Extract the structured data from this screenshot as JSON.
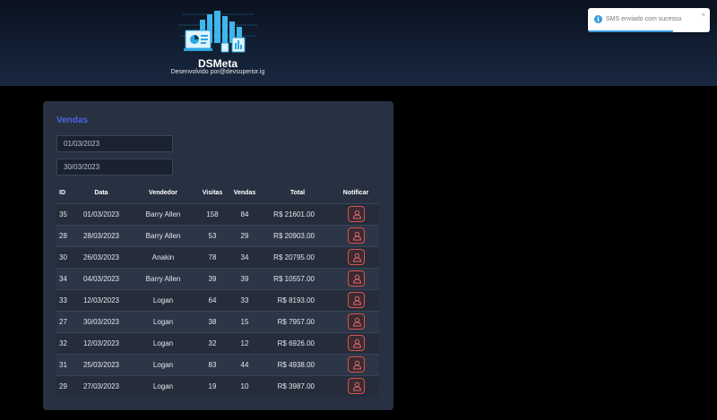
{
  "header": {
    "brand": "DSMeta",
    "subtitle": "Desenvolvido por@devsuperior.ig"
  },
  "toast": {
    "message": "SMS enviado com sucesso",
    "close": "×",
    "icon": "info-icon",
    "progress": 0.7
  },
  "card": {
    "title": "Vendas",
    "min_date": "01/03/2023",
    "max_date": "30/03/2023"
  },
  "table": {
    "headers": {
      "id": "ID",
      "date": "Data",
      "seller": "Vendedor",
      "visits": "Visitas",
      "deals": "Vendas",
      "total": "Total",
      "notify": "Notificar"
    },
    "rows": [
      {
        "id": "35",
        "date": "01/03/2023",
        "seller": "Barry Allen",
        "visits": "158",
        "deals": "84",
        "total": "R$ 21601.00"
      },
      {
        "id": "28",
        "date": "28/03/2023",
        "seller": "Barry Allen",
        "visits": "53",
        "deals": "29",
        "total": "R$ 20903.00"
      },
      {
        "id": "30",
        "date": "26/03/2023",
        "seller": "Anakin",
        "visits": "78",
        "deals": "34",
        "total": "R$ 20795.00"
      },
      {
        "id": "34",
        "date": "04/03/2023",
        "seller": "Barry Allen",
        "visits": "39",
        "deals": "39",
        "total": "R$ 10557.00"
      },
      {
        "id": "33",
        "date": "12/03/2023",
        "seller": "Logan",
        "visits": "64",
        "deals": "33",
        "total": "R$ 8193.00"
      },
      {
        "id": "27",
        "date": "30/03/2023",
        "seller": "Logan",
        "visits": "38",
        "deals": "15",
        "total": "R$ 7957.00"
      },
      {
        "id": "32",
        "date": "12/03/2023",
        "seller": "Logan",
        "visits": "32",
        "deals": "12",
        "total": "R$ 6926.00"
      },
      {
        "id": "31",
        "date": "25/03/2023",
        "seller": "Logan",
        "visits": "83",
        "deals": "44",
        "total": "R$ 4938.00"
      },
      {
        "id": "29",
        "date": "27/03/2023",
        "seller": "Logan",
        "visits": "19",
        "deals": "10",
        "total": "R$ 3987.00"
      }
    ]
  },
  "colors": {
    "accent": "#4d65e0",
    "notify_border": "#d9534f",
    "toast_info": "#3498db"
  }
}
